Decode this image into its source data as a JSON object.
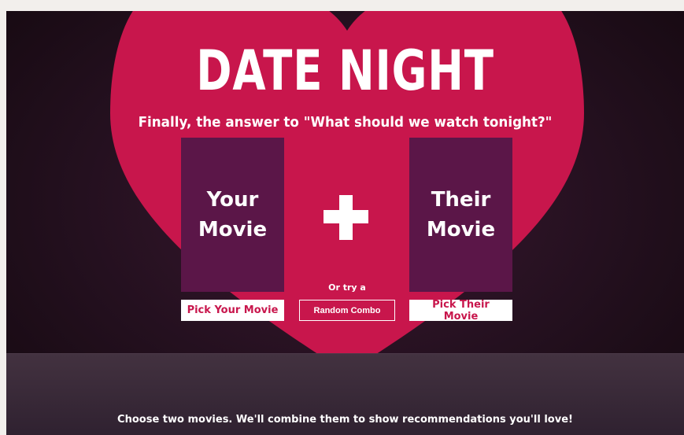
{
  "app": {
    "title": "DATE NIGHT",
    "tagline": "Finally, the answer to \"What should we watch tonight?\""
  },
  "cards": {
    "left": {
      "line1": "Your",
      "line2": "Movie"
    },
    "right": {
      "line1": "Their",
      "line2": "Movie"
    }
  },
  "actions": {
    "or_try": "Or try a",
    "random_label": "Random Combo",
    "pick_your_label": "Pick Your Movie",
    "pick_their_label": "Pick Their Movie"
  },
  "footer": {
    "text": "Choose two movies. We'll combine them to show recommendations you'll love!"
  },
  "colors": {
    "heart": "#c8164c",
    "card": "#5b1648",
    "background_dark": "#1b0b16",
    "footer": "#3a2a38"
  },
  "icons": {
    "plus": "plus-icon",
    "heart": "heart-shape"
  }
}
